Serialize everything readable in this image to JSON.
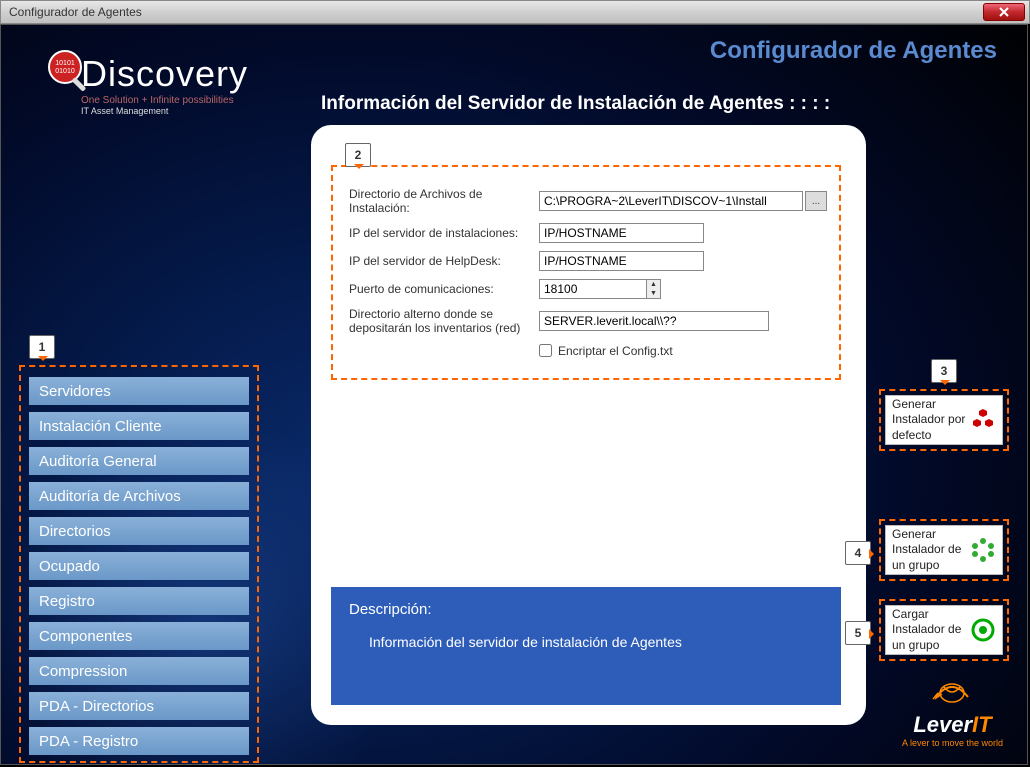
{
  "window": {
    "title": "Configurador de Agentes"
  },
  "header": {
    "title": "Configurador de Agentes"
  },
  "logo": {
    "main": "iscovery",
    "tagline1": "One Solution + Infinite possibilities",
    "tagline2": "IT Asset Management"
  },
  "subtitle": "Información del Servidor de Instalación de Agentes : : : :",
  "callouts": {
    "c1": "1",
    "c2": "2",
    "c3": "3",
    "c4": "4",
    "c5": "5"
  },
  "sidebar": {
    "items": [
      {
        "label": "Servidores"
      },
      {
        "label": "Instalación Cliente"
      },
      {
        "label": "Auditoría General"
      },
      {
        "label": "Auditoría de Archivos"
      },
      {
        "label": "Directorios"
      },
      {
        "label": "Ocupado"
      },
      {
        "label": "Registro"
      },
      {
        "label": "Componentes"
      },
      {
        "label": "Compression"
      },
      {
        "label": "PDA - Directorios"
      },
      {
        "label": "PDA - Registro"
      }
    ]
  },
  "form": {
    "rows": {
      "install_dir": {
        "label": "Directorio de Archivos de Instalación:",
        "value": "C:\\PROGRA~2\\LeverIT\\DISCOV~1\\Install"
      },
      "ip_install": {
        "label": "IP del servidor de instalaciones:",
        "value": "IP/HOSTNAME"
      },
      "ip_helpdesk": {
        "label": "IP del servidor de HelpDesk:",
        "value": "IP/HOSTNAME"
      },
      "port": {
        "label": "Puerto de comunicaciones:",
        "value": "18100"
      },
      "alt_dir": {
        "label": "Directorio alterno donde se depositarán los inventarios (red)",
        "value": "SERVER.leverit.local\\\\??"
      },
      "encrypt": {
        "label": "Encriptar el Config.txt"
      }
    },
    "browse": "..."
  },
  "description": {
    "heading": "Descripción:",
    "text": "Información del servidor de instalación de Agentes"
  },
  "right_buttons": {
    "b1": "Generar Instalador por defecto",
    "b2": "Generar Instalador de un grupo",
    "b3": "Cargar Instalador de un grupo"
  },
  "footer_logo": {
    "brand_prefix": "Lever",
    "brand_suffix": "IT",
    "tagline": "A lever to move the world"
  }
}
